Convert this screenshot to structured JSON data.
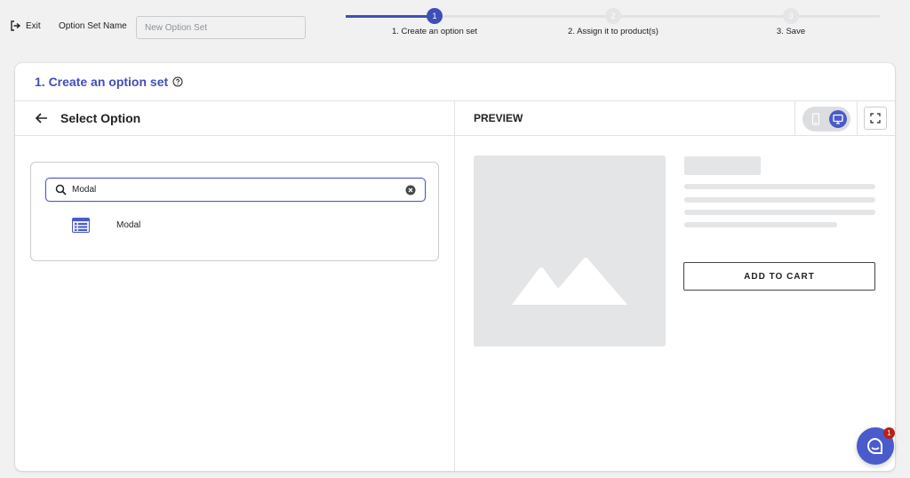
{
  "topbar": {
    "exit_label": "Exit",
    "option_set_name_label": "Option Set Name",
    "option_set_name_placeholder": "New Option Set",
    "option_set_name_value": ""
  },
  "stepper": {
    "steps": [
      {
        "number": "1",
        "label": "1. Create an option set",
        "state": "active"
      },
      {
        "number": "2",
        "label": "2. Assign it to product(s)",
        "state": "inactive"
      },
      {
        "number": "3",
        "label": "3. Save",
        "state": "inactive"
      }
    ]
  },
  "card": {
    "title": "1. Create an option set"
  },
  "select_option": {
    "title": "Select Option",
    "search_value": "Modal",
    "results": [
      {
        "label": "Modal",
        "icon": "list-icon"
      }
    ]
  },
  "preview": {
    "title": "PREVIEW",
    "add_to_cart_label": "ADD TO CART",
    "view_mode": "desktop"
  },
  "chat": {
    "badge_count": "1"
  },
  "colors": {
    "accent": "#3f4fb8",
    "accent_light": "#4a5bcb",
    "placeholder_gray": "#e4e5e7",
    "badge_red": "#b42318"
  }
}
